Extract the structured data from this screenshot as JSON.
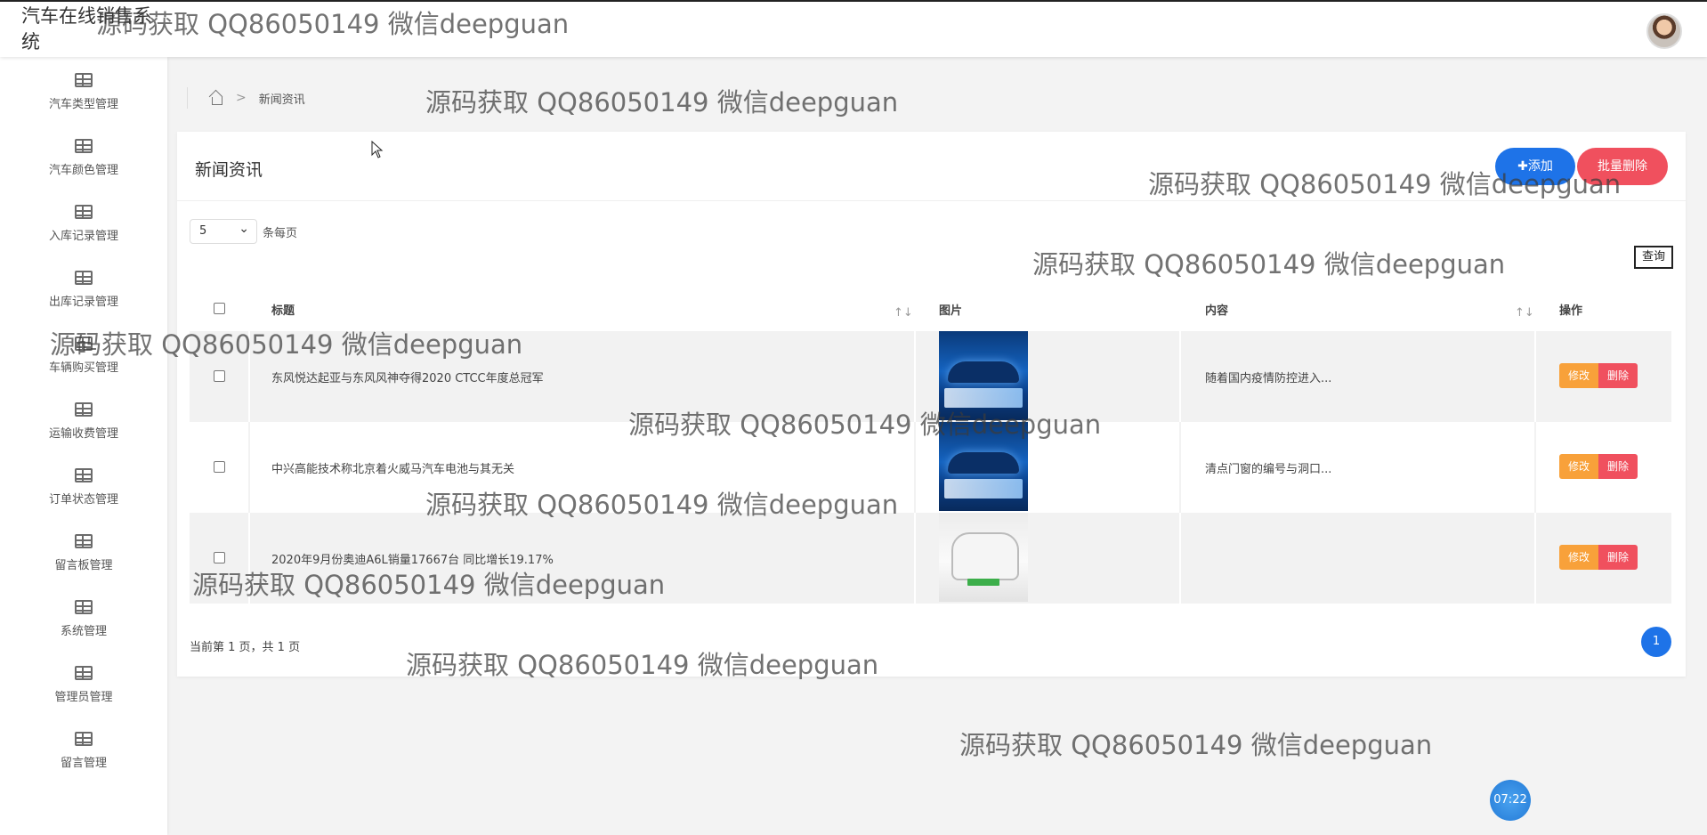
{
  "app": {
    "title": "汽车在线销售系统"
  },
  "sidebar": {
    "items": [
      {
        "label": "汽车类型管理"
      },
      {
        "label": "汽车颜色管理"
      },
      {
        "label": "入库记录管理"
      },
      {
        "label": "出库记录管理"
      },
      {
        "label": "车辆购买管理"
      },
      {
        "label": "运输收费管理"
      },
      {
        "label": "订单状态管理"
      },
      {
        "label": "留言板管理"
      },
      {
        "label": "系统管理"
      },
      {
        "label": "管理员管理"
      },
      {
        "label": "留言管理"
      }
    ]
  },
  "breadcrumb": {
    "current": "新闻资讯",
    "separator": ">"
  },
  "card": {
    "title": "新闻资讯",
    "add_label": "✚添加",
    "batch_delete_label": "批量删除",
    "page_size": "5",
    "page_size_suffix": "条每页",
    "query_label": "查询"
  },
  "table": {
    "headers": {
      "title": "标题",
      "image": "图片",
      "content": "内容",
      "actions": "操作"
    },
    "sort_glyph": "↑↓",
    "rows": [
      {
        "title": "东风悦达起亚与东风风神夺得2020 CTCC年度总冠军",
        "image": "blue-poster-image",
        "content": "随着国内疫情防控进入...",
        "edit": "修改",
        "delete": "删除"
      },
      {
        "title": "中兴高能技术称北京着火威马汽车电池与其无关",
        "image": "blue-poster-image",
        "content": "清点门窗的编号与洞口...",
        "edit": "修改",
        "delete": "删除"
      },
      {
        "title": "2020年9月份奥迪A6L销量17667台 同比增长19.17%",
        "image": "white-car-image",
        "content": "",
        "edit": "修改",
        "delete": "删除"
      }
    ]
  },
  "pager": {
    "info": "当前第 1 页，共 1 页",
    "current": "1"
  },
  "clock": {
    "time": "07:22"
  },
  "watermarks": [
    "源码获取 QQ86050149 微信deepguan",
    "源码获取 QQ86050149 微信deepguan",
    "源码获取 QQ86050149 微信deepguan",
    "源码获取 QQ86050149 微信deepguan",
    "源码获取 QQ86050149 微信deepguan",
    "源码获取 QQ86050149 微信deepguan",
    "源码获取 QQ86050149 微信deepguan",
    "源码获取 QQ86050149 微信deepguan",
    "源码获取 QQ86050149 微信deepguan",
    "源码获取 QQ86050149 微信deepguan"
  ],
  "colors": {
    "primary": "#1e73e8",
    "danger": "#f0505e",
    "warning": "#f8a13a"
  }
}
